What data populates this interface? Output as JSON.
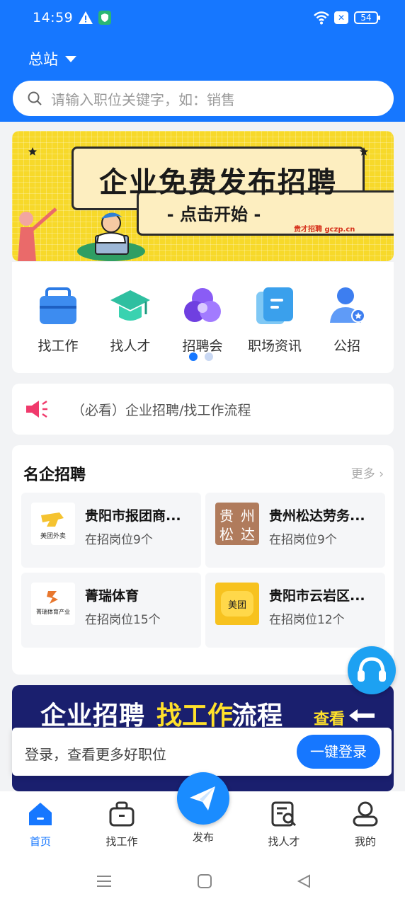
{
  "status_bar": {
    "time": "14:59",
    "battery": "54"
  },
  "header": {
    "site_label": "总站",
    "search_placeholder": "请输入职位关键字，如：销售"
  },
  "banner": {
    "title": "企业免费发布招聘",
    "subtitle": "- 点击开始 -",
    "brand": "贵才招聘 gczp.cn"
  },
  "categories": [
    {
      "label": "找工作",
      "icon": "briefcase-icon"
    },
    {
      "label": "找人才",
      "icon": "graduation-cap-icon"
    },
    {
      "label": "招聘会",
      "icon": "circles-icon"
    },
    {
      "label": "职场资讯",
      "icon": "document-icon"
    },
    {
      "label": "公招",
      "icon": "user-badge-icon"
    }
  ],
  "notice": {
    "text": "（必看）企业招聘/找工作流程"
  },
  "famous": {
    "title": "名企招聘",
    "more": "更多",
    "companies": [
      {
        "name": "贵阳市报团商...",
        "count": "在招岗位9个",
        "logo_text": "美团外卖"
      },
      {
        "name": "贵州松达劳务...",
        "count": "在招岗位9个",
        "logo_text": "贵州松达"
      },
      {
        "name": "菁瑞体育",
        "count": "在招岗位15个",
        "logo_text": "菁瑞体育产业"
      },
      {
        "name": "贵阳市云岩区...",
        "count": "在招岗位12个",
        "logo_text": "美团"
      }
    ]
  },
  "banner2": {
    "part1": "企业招聘",
    "part2": "找工作",
    "part3": "流程",
    "cta": "查看"
  },
  "login_bar": {
    "message": "登录，查看更多好职位",
    "button": "一键登录"
  },
  "tabbar": {
    "items": [
      {
        "label": "首页",
        "icon": "home-icon"
      },
      {
        "label": "找工作",
        "icon": "briefcase-icon"
      },
      {
        "label": "发布",
        "icon": "send-icon"
      },
      {
        "label": "找人才",
        "icon": "search-document-icon"
      },
      {
        "label": "我的",
        "icon": "user-icon"
      }
    ]
  },
  "colors": {
    "primary": "#1677ff",
    "banner_yellow": "#f7d92a",
    "banner2_navy": "#1a1f6e"
  }
}
